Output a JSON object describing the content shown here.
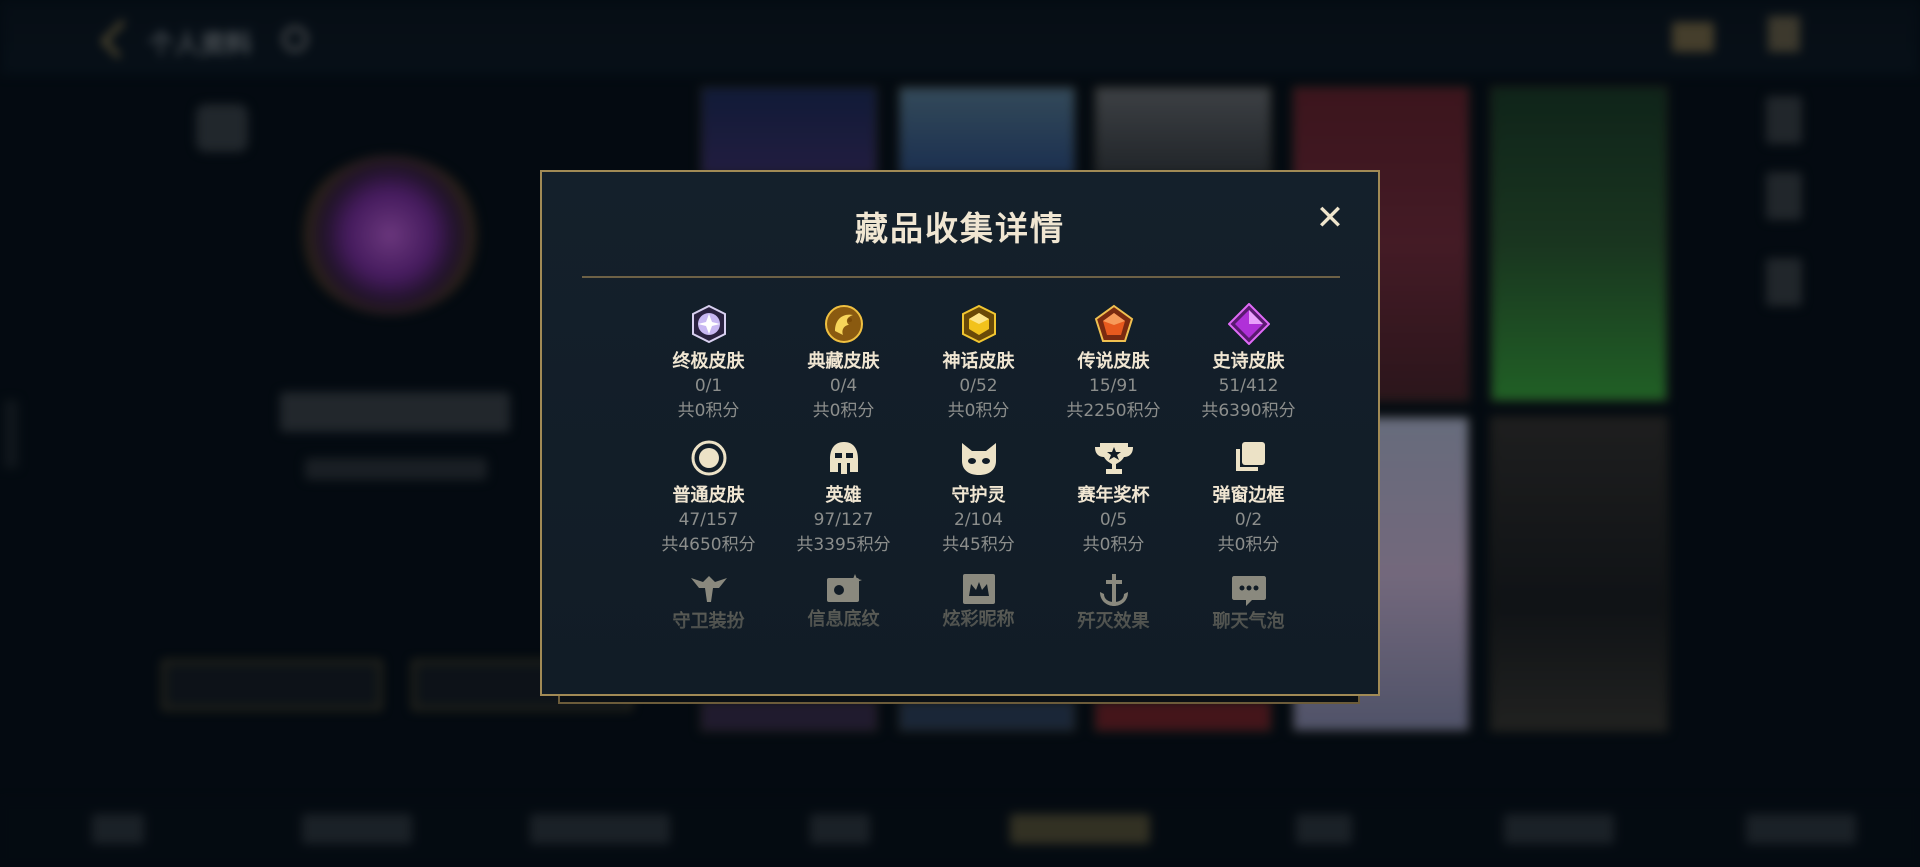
{
  "background": {
    "title": "个人资料"
  },
  "dialog": {
    "title": "藏品收集详情",
    "close_label": "✕",
    "rows": [
      [
        {
          "icon": "ultimate-skin-icon",
          "label": "终极皮肤",
          "count": "0/1",
          "points": "共0积分",
          "color": "#b9a7e8"
        },
        {
          "icon": "prestige-skin-icon",
          "label": "典藏皮肤",
          "count": "0/4",
          "points": "共0积分",
          "color": "#d6a62a"
        },
        {
          "icon": "mythic-skin-icon",
          "label": "神话皮肤",
          "count": "0/52",
          "points": "共0积分",
          "color": "#e2b21c"
        },
        {
          "icon": "legendary-skin-icon",
          "label": "传说皮肤",
          "count": "15/91",
          "points": "共2250积分",
          "color": "#e7632a"
        },
        {
          "icon": "epic-skin-icon",
          "label": "史诗皮肤",
          "count": "51/412",
          "points": "共6390积分",
          "color": "#b13ad9"
        }
      ],
      [
        {
          "icon": "standard-skin-icon",
          "label": "普通皮肤",
          "count": "47/157",
          "points": "共4650积分",
          "color": "#e8dcc0"
        },
        {
          "icon": "champion-helmet-icon",
          "label": "英雄",
          "count": "97/127",
          "points": "共3395积分",
          "color": "#e8dcc0"
        },
        {
          "icon": "companion-icon",
          "label": "守护灵",
          "count": "2/104",
          "points": "共45积分",
          "color": "#e8dcc0"
        },
        {
          "icon": "trophy-icon",
          "label": "赛年奖杯",
          "count": "0/5",
          "points": "共0积分",
          "color": "#e8dcc0"
        },
        {
          "icon": "popup-frame-icon",
          "label": "弹窗边框",
          "count": "0/2",
          "points": "共0积分",
          "color": "#e8dcc0"
        }
      ],
      [
        {
          "icon": "ward-skin-icon",
          "label": "守卫装扮",
          "color": "#e8dcc0"
        },
        {
          "icon": "banner-icon",
          "label": "信息底纹",
          "color": "#e8dcc0"
        },
        {
          "icon": "nickname-icon",
          "label": "炫彩昵称",
          "color": "#e8dcc0"
        },
        {
          "icon": "finisher-effect-icon",
          "label": "歼灭效果",
          "color": "#e8dcc0"
        },
        {
          "icon": "chat-bubble-icon",
          "label": "聊天气泡",
          "color": "#e8dcc0"
        }
      ]
    ]
  },
  "colors": {
    "accent_gold": "#a18a55",
    "title_text": "#f0e6d2",
    "muted_text": "#8c8e8c"
  }
}
